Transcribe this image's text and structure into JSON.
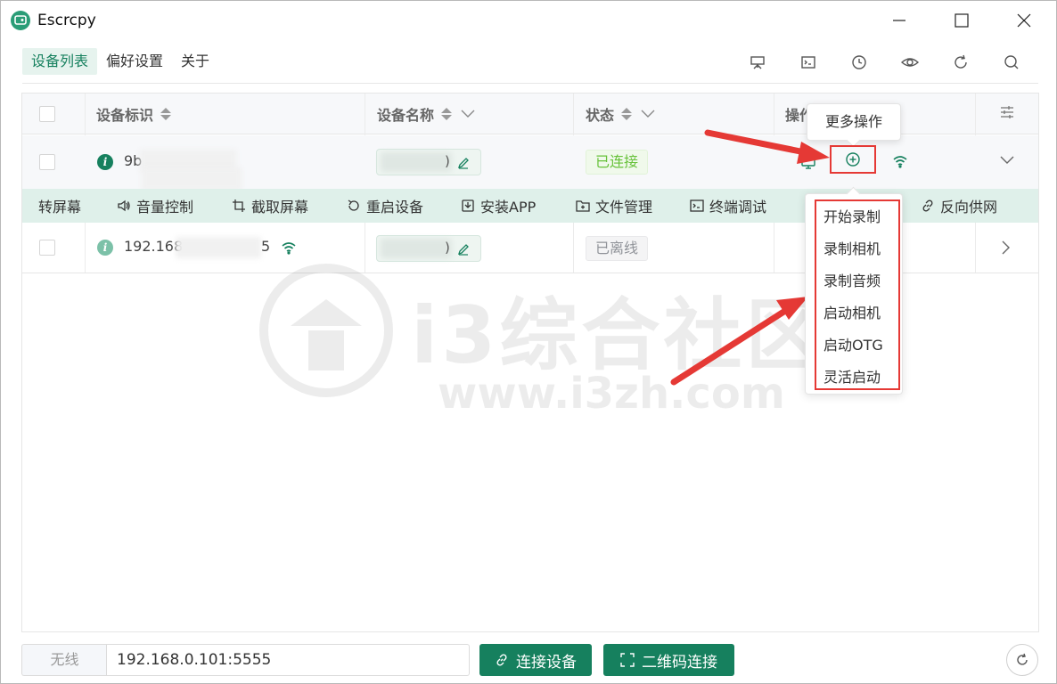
{
  "window": {
    "title": "Escrcpy",
    "controls": [
      "minimize-icon",
      "maximize-icon",
      "close-icon"
    ]
  },
  "nav": {
    "tabs": [
      {
        "label": "设备列表",
        "active": true
      },
      {
        "label": "偏好设置",
        "active": false
      },
      {
        "label": "关于",
        "active": false
      }
    ]
  },
  "toolbar": {
    "icons": [
      "presentation-icon",
      "terminal-icon",
      "clock-icon",
      "eye-icon",
      "refresh-icon",
      "search-icon"
    ]
  },
  "table": {
    "headers": {
      "device_id": "设备标识",
      "device_name": "设备名称",
      "status": "状态",
      "actions": "操作"
    },
    "rows": [
      {
        "device_id": "9b",
        "name_tail": ")",
        "status": "已连接"
      },
      {
        "device_id_prefix": "192.168",
        "device_id_suffix": "5",
        "name_tail": ")",
        "status": "已离线"
      }
    ],
    "expanded_actions": [
      {
        "label": "转屏幕",
        "icon": ""
      },
      {
        "label": "音量控制",
        "icon": "speaker-icon"
      },
      {
        "label": "截取屏幕",
        "icon": "crop-icon"
      },
      {
        "label": "重启设备",
        "icon": "restart-icon"
      },
      {
        "label": "安装APP",
        "icon": "download-box-icon"
      },
      {
        "label": "文件管理",
        "icon": "folder-icon"
      },
      {
        "label": "终端调试",
        "icon": "terminal-icon"
      },
      {
        "label": "反向供网",
        "icon": "link-icon"
      }
    ]
  },
  "tooltip": {
    "label": "更多操作"
  },
  "dropdown": {
    "items": [
      "开始录制",
      "录制相机",
      "录制音频",
      "启动相机",
      "启动OTG",
      "灵活启动"
    ]
  },
  "watermark": {
    "text_big": "i3综合社区",
    "text_small": "www.i3zh.com"
  },
  "footer": {
    "mode_label": "无线",
    "address_value": "192.168.0.101:5555",
    "connect_button": "连接设备",
    "qrcode_button": "二维码连接"
  },
  "colors": {
    "brand": "#16805e",
    "connected": "#67c23a",
    "offline": "#909399",
    "annotation_red": "#e53935"
  }
}
